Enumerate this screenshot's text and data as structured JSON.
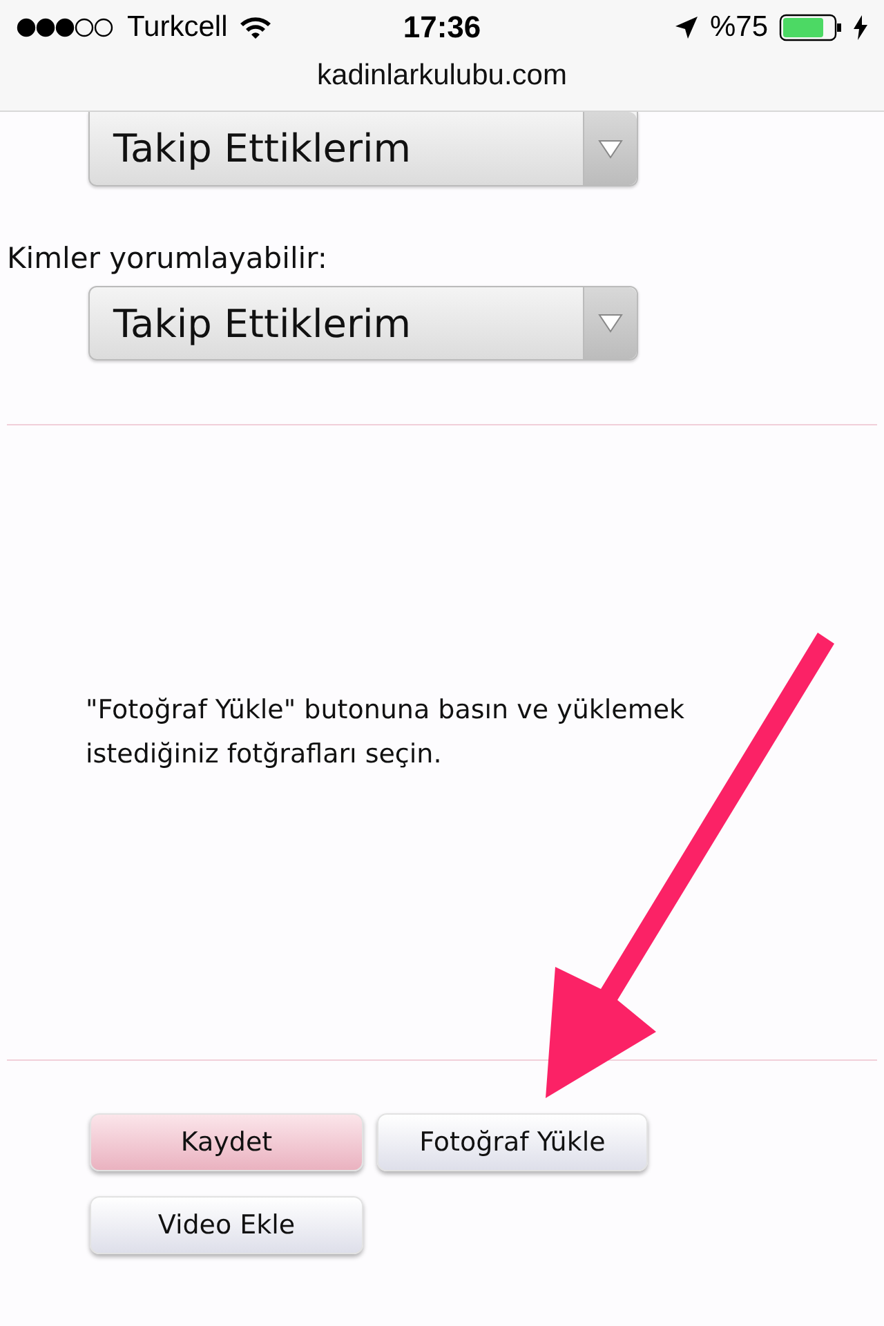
{
  "status_bar": {
    "carrier": "Turkcell",
    "time": "17:36",
    "battery": "%75",
    "charging": true
  },
  "address_bar": {
    "url": "kadinlarkulubu.com"
  },
  "fields": [
    {
      "value": "Takip Ettiklerim"
    },
    {
      "label": "Kimler yorumlayabilir:",
      "value": "Takip Ettiklerim"
    }
  ],
  "instruction": "\"Fotoğraf Yükle\" butonuna basın ve yüklemek istediğiniz fotğrafları seçin.",
  "buttons": [
    {
      "label": "Kaydet",
      "kind": "primary"
    },
    {
      "label": "Fotoğraf Yükle",
      "kind": "secondary"
    },
    {
      "label": "Video Ekle",
      "kind": "secondary"
    }
  ]
}
